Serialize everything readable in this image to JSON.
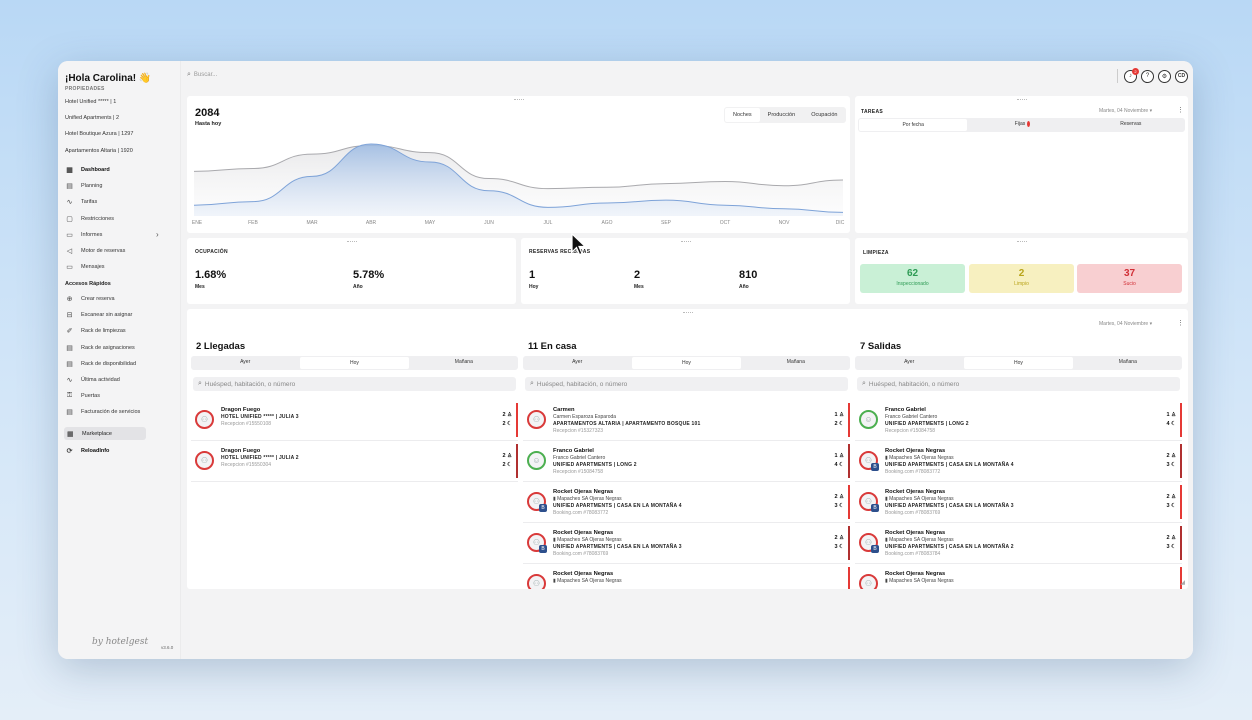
{
  "sidebar": {
    "greeting": "¡Hola Carolina! 👋",
    "properties_label": "PROPIEDADES",
    "properties": [
      "Hotel Unified ***** | 1",
      "Unified Apartments | 2",
      "Hotel Boutique Azura | 1297",
      "Apartamentos Altaria | 1920"
    ],
    "nav": [
      {
        "label": "Dashboard",
        "icon": "grid-icon"
      },
      {
        "label": "Planning",
        "icon": "calendar-icon"
      },
      {
        "label": "Tarifas",
        "icon": "trend-icon"
      },
      {
        "label": "Restricciones",
        "icon": "lock-icon"
      },
      {
        "label": "Informes",
        "icon": "folder-icon"
      },
      {
        "label": "Motor de reservas",
        "icon": "megaphone-icon"
      },
      {
        "label": "Mensajes",
        "icon": "chat-icon"
      }
    ],
    "quick_title": "Accesos Rápidos",
    "quick": [
      {
        "label": "Crear reserva",
        "icon": "plus-icon"
      },
      {
        "label": "Escanear sin asignar",
        "icon": "scan-icon"
      },
      {
        "label": "Rack de limpiezas",
        "icon": "broom-icon"
      },
      {
        "label": "Rack de asignaciones",
        "icon": "calendar-icon"
      },
      {
        "label": "Rack de disponibilidad",
        "icon": "calendar-icon"
      },
      {
        "label": "Última actividad",
        "icon": "activity-icon"
      },
      {
        "label": "Puertas",
        "icon": "key-icon"
      },
      {
        "label": "Facturación de servicios",
        "icon": "invoice-icon"
      }
    ],
    "marketplace": "Marketplace",
    "reload": "ReloadInfo",
    "brand": "by hotelgest",
    "version": "v3.6.0"
  },
  "topbar": {
    "search_placeholder": "Buscar...",
    "notif_count": "2",
    "avatar_initials": "CD",
    "help": "?",
    "settings": "⚙"
  },
  "chart": {
    "value": "2084",
    "subtitle": "Hasta hoy",
    "tabs": [
      "Noches",
      "Producción",
      "Ocupación"
    ],
    "selected_tab": 0,
    "chart_data": {
      "type": "area",
      "categories": [
        "ENE",
        "FEB",
        "MAR",
        "ABR",
        "MAY",
        "JUN",
        "JUL",
        "AGO",
        "SEP",
        "OCT",
        "NOV",
        "DIC"
      ],
      "series": [
        {
          "values": [
            0.62,
            0.66,
            0.86,
            0.98,
            0.88,
            0.52,
            0.38,
            0.4,
            0.45,
            0.48,
            0.42,
            0.5
          ]
        },
        {
          "values": [
            0.15,
            0.2,
            0.55,
            1.0,
            0.75,
            0.35,
            0.12,
            0.18,
            0.22,
            0.15,
            0.1,
            0.05
          ]
        }
      ]
    }
  },
  "tareas": {
    "title": "TAREAS",
    "date": "Martes, 04 Noviembre",
    "tabs": [
      "Por fecha",
      "Fijas",
      "Reservas"
    ]
  },
  "ocupacion": {
    "title": "OCUPACIÓN",
    "values": [
      {
        "v": "1.68%",
        "l": "Mes"
      },
      {
        "v": "5.78%",
        "l": "Año"
      }
    ]
  },
  "reservas": {
    "title": "RESERVAS RECIBIDAS",
    "values": [
      {
        "v": "1",
        "l": "Hoy"
      },
      {
        "v": "2",
        "l": "Mes"
      },
      {
        "v": "810",
        "l": "Año"
      }
    ]
  },
  "limpieza": {
    "title": "LIMPIEZA",
    "boxes": [
      {
        "n": "62",
        "t": "Inspeccionado",
        "bg": "#c9f0d6",
        "fg": "#2e9b55"
      },
      {
        "n": "2",
        "t": "Limpio",
        "bg": "#f7f0c0",
        "fg": "#b9a41a"
      },
      {
        "n": "37",
        "t": "Sucio",
        "bg": "#f8cfd1",
        "fg": "#d12f36"
      }
    ]
  },
  "bottom": {
    "date": "Martes, 04 Noviembre",
    "day_tabs": [
      "Ayer",
      "Hoy",
      "Mañana"
    ],
    "search_placeholder": "Huésped, habitación, o número",
    "columns": [
      {
        "title": "2 Llegadas",
        "rows": [
          {
            "name": "Dragon Fuego",
            "l2": "",
            "l3": "HOTEL UNIFIED ***** | JULIA 3",
            "l4": "Recepcion #15550108",
            "adults": "2",
            "nights": "2",
            "avatar": "user",
            "tag": ""
          },
          {
            "name": "Dragon Fuego",
            "l2": "",
            "l3": "HOTEL UNIFIED ***** | JULIA 2",
            "l4": "Recepcion #15550304",
            "adults": "2",
            "nights": "2",
            "avatar": "user",
            "tag": ""
          }
        ]
      },
      {
        "title": "11 En casa",
        "rows": [
          {
            "name": "Carmen",
            "l2": "Carmen Esparoza Esparoda",
            "l3": "APARTAMENTOS ALTARIA | APARTAMENTO BOSQUE 101",
            "l4": "Recepcion #15327323",
            "adults": "1",
            "nights": "2",
            "avatar": "user",
            "tag": ""
          },
          {
            "name": "Franco Gabriel",
            "l2": "Franco Gabriel Cantero",
            "l3": "UNIFIED APARTMENTS | LONG 2",
            "l4": "Recepcion #15084758",
            "adults": "1",
            "nights": "4",
            "avatar": "photo",
            "tag": ""
          },
          {
            "name": "Rocket Ojeras Negras",
            "l2": "▮ Mapaches SA Ojeras Negras",
            "l3": "UNIFIED APARTMENTS | CASA EN LA MONTAÑA 4",
            "l4": "Booking.com #78083772",
            "adults": "2",
            "nights": "3",
            "avatar": "user",
            "tag": "B"
          },
          {
            "name": "Rocket Ojeras Negras",
            "l2": "▮ Mapaches SA Ojeras Negras",
            "l3": "UNIFIED APARTMENTS | CASA EN LA MONTAÑA 3",
            "l4": "Booking.com #78083769",
            "adults": "2",
            "nights": "3",
            "avatar": "user",
            "tag": "B"
          },
          {
            "name": "Rocket Ojeras Negras",
            "l2": "▮ Mapaches SA Ojeras Negras",
            "l3": "",
            "l4": "",
            "adults": "",
            "nights": "",
            "avatar": "user",
            "tag": ""
          }
        ]
      },
      {
        "title": "7 Salidas",
        "rows": [
          {
            "name": "Franco Gabriel",
            "l2": "Franco Gabriel Cantero",
            "l3": "UNIFIED APARTMENTS | LONG 2",
            "l4": "Recepcion #15084758",
            "adults": "1",
            "nights": "4",
            "avatar": "photo",
            "tag": ""
          },
          {
            "name": "Rocket Ojeras Negras",
            "l2": "▮ Mapaches SA Ojeras Negras",
            "l3": "UNIFIED APARTMENTS | CASA EN LA MONTAÑA 4",
            "l4": "Booking.com #78083772",
            "adults": "2",
            "nights": "3",
            "avatar": "user",
            "tag": "B"
          },
          {
            "name": "Rocket Ojeras Negras",
            "l2": "▮ Mapaches SA Ojeras Negras",
            "l3": "UNIFIED APARTMENTS | CASA EN LA MONTAÑA 3",
            "l4": "Booking.com #78083769",
            "adults": "2",
            "nights": "3",
            "avatar": "user",
            "tag": "B"
          },
          {
            "name": "Rocket Ojeras Negras",
            "l2": "▮ Mapaches SA Ojeras Negras",
            "l3": "UNIFIED APARTMENTS | CASA EN LA MONTAÑA 2",
            "l4": "Booking.com #78083784",
            "adults": "2",
            "nights": "3",
            "avatar": "user",
            "tag": "B"
          },
          {
            "name": "Rocket Ojeras Negras",
            "l2": "▮ Mapaches SA Ojeras Negras",
            "l3": "",
            "l4": "",
            "adults": "",
            "nights": "",
            "avatar": "user",
            "tag": ""
          }
        ]
      }
    ]
  }
}
